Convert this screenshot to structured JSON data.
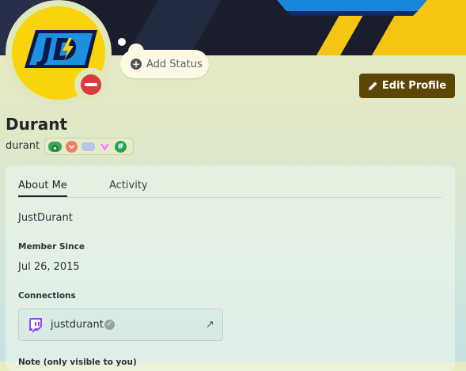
{
  "profile": {
    "display_name": "Durant",
    "username": "durant",
    "avatar_text": "JD",
    "status": "do-not-disturb"
  },
  "actions": {
    "add_status_label": "Add Status",
    "edit_profile_label": "Edit Profile"
  },
  "badges": [
    "hypesquad-badge",
    "nitro-boost-badge",
    "quest-badge",
    "nitro-badge",
    "originally-known-as-badge"
  ],
  "tabs": [
    {
      "label": "About Me",
      "active": true
    },
    {
      "label": "Activity",
      "active": false
    }
  ],
  "about_me": "JustDurant",
  "member_since": {
    "title": "Member Since",
    "date": "Jul 26, 2015"
  },
  "connections": {
    "title": "Connections",
    "items": [
      {
        "service": "twitch",
        "name": "justdurant",
        "verified": true
      }
    ]
  },
  "note_title": "Note (only visible to you)",
  "colors": {
    "accent": "#5c4606",
    "avatar_bg": "#f9d40b",
    "dnd": "#d83c3e",
    "twitch": "#9146ff"
  }
}
